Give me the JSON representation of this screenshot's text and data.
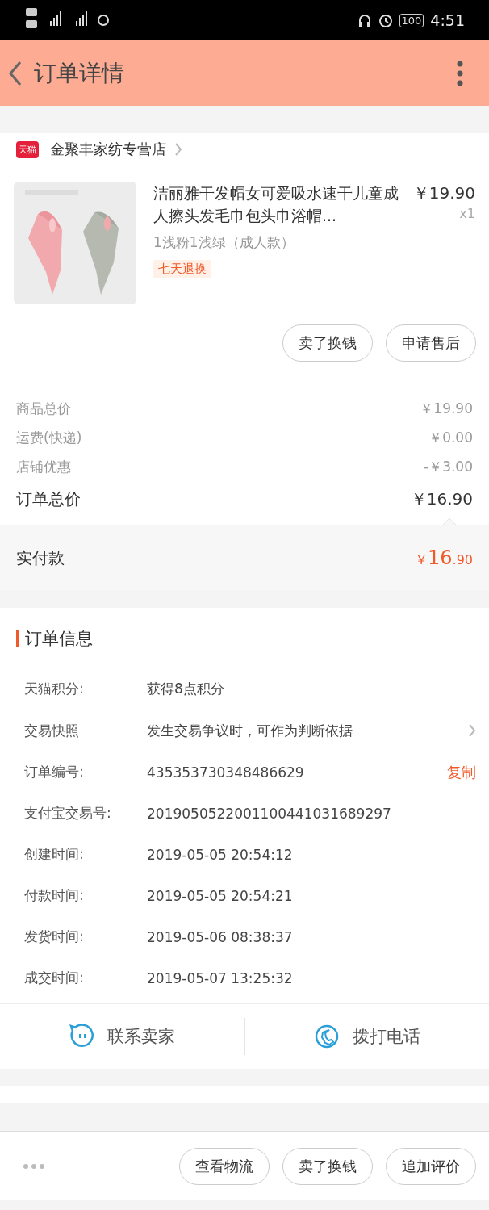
{
  "status_bar": {
    "time": "4:51",
    "battery": "100"
  },
  "header": {
    "title": "订单详情"
  },
  "shop": {
    "badge": "天猫",
    "name": "金聚丰家纺专营店"
  },
  "product": {
    "title": "洁丽雅干发帽女可爱吸水速干儿童成人擦头发毛巾包头巾浴帽...",
    "price": "￥19.90",
    "quantity": "x1",
    "sku": "1浅粉1浅绿（成人款）",
    "tag": "七天退换"
  },
  "item_actions": [
    "卖了换钱",
    "申请售后"
  ],
  "summary": [
    {
      "label": "商品总价",
      "value": "￥19.90",
      "kind": "minor"
    },
    {
      "label": "运费(快递)",
      "value": "￥0.00",
      "kind": "minor"
    },
    {
      "label": "店铺优惠",
      "value": "-￥3.00",
      "kind": "minor"
    },
    {
      "label": "订单总价",
      "value": "￥16.90",
      "kind": "total"
    }
  ],
  "paid": {
    "label": "实付款",
    "currency": "￥",
    "integer": "16",
    "decimal": ".90"
  },
  "order_info": {
    "title": "订单信息",
    "rows": [
      {
        "label": "天猫积分:",
        "value": "获得8点积分",
        "kind": "plain"
      },
      {
        "label": "交易快照",
        "value": "发生交易争议时，可作为判断依据",
        "kind": "link"
      },
      {
        "label": "订单编号:",
        "value": "435353730348486629",
        "kind": "copy",
        "action": "复制"
      },
      {
        "label": "支付宝交易号:",
        "value": "2019050522001100441031689297",
        "kind": "plain"
      },
      {
        "label": "创建时间:",
        "value": "2019-05-05 20:54:12",
        "kind": "plain"
      },
      {
        "label": "付款时间:",
        "value": "2019-05-05 20:54:21",
        "kind": "plain"
      },
      {
        "label": "发货时间:",
        "value": "2019-05-06 08:38:37",
        "kind": "plain"
      },
      {
        "label": "成交时间:",
        "value": "2019-05-07 13:25:32",
        "kind": "plain"
      }
    ]
  },
  "contact": [
    {
      "label": "联系卖家",
      "kind": "chat"
    },
    {
      "label": "拨打电话",
      "kind": "phone"
    }
  ],
  "bottom_actions": [
    "查看物流",
    "卖了换钱",
    "追加评价"
  ]
}
